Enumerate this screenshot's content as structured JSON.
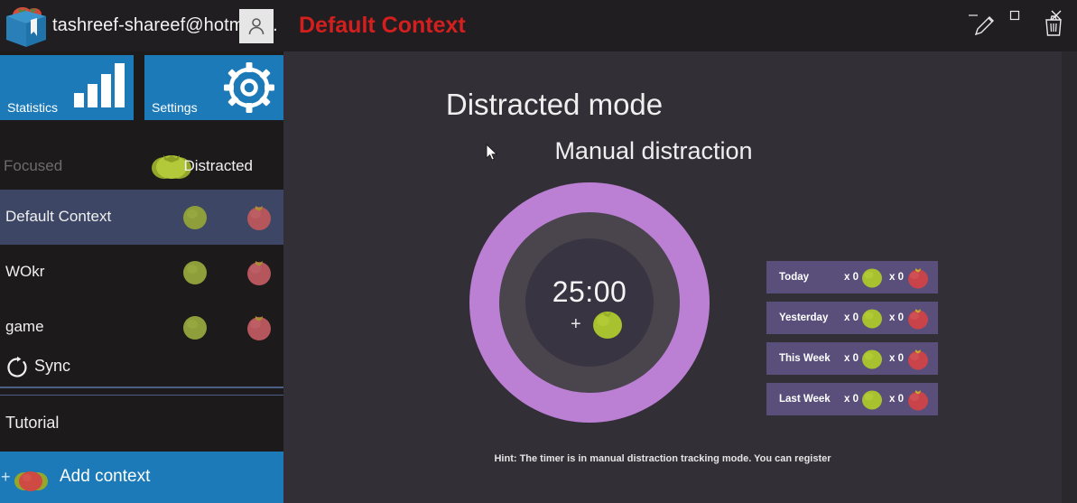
{
  "titlebar": {
    "logo_icon": "tomato-crate-logo",
    "account_name": "tashreef-shareef@hotmail...",
    "avatar_icon": "person-icon",
    "context_title": "Default Context",
    "minimize_label": "–",
    "maximize_label": "□",
    "close_label": "✕",
    "edit_icon": "pencil-icon",
    "delete_icon": "trash-icon"
  },
  "sidebar": {
    "tiles": [
      {
        "label": "Statistics",
        "icon": "bar-chart-icon"
      },
      {
        "label": "Settings",
        "icon": "gear-icon"
      }
    ],
    "mode": {
      "focused_label": "Focused",
      "distracted_label": "Distracted",
      "active": "Distracted",
      "toggle_icon": "green-tomato-toggle"
    },
    "contexts": [
      {
        "name": "Default Context",
        "selected": true
      },
      {
        "name": "WOkr",
        "selected": false
      },
      {
        "name": "game",
        "selected": false
      }
    ],
    "sync_label": "Sync",
    "sync_icon": "refresh-icon",
    "tutorial_label": "Tutorial",
    "add_context_label": "Add context",
    "add_context_plus": "+",
    "add_context_icon": "tomato-icon"
  },
  "main": {
    "title": "Distracted mode",
    "subtitle": "Manual distraction",
    "timer_value": "25:00",
    "timer_plus": "+",
    "timer_tomato_icon": "green-tomato-icon",
    "hint": "Hint: The timer is in manual distraction tracking mode. You can register"
  },
  "stats": {
    "rows": [
      {
        "label": "Today",
        "green_count": "x 0",
        "red_count": "x 0"
      },
      {
        "label": "Yesterday",
        "green_count": "x 0",
        "red_count": "x 0"
      },
      {
        "label": "This Week",
        "green_count": "x 0",
        "red_count": "x 0"
      },
      {
        "label": "Last Week",
        "green_count": "x 0",
        "red_count": "x 0"
      }
    ]
  },
  "colors": {
    "accent_blue": "#1c7ab8",
    "title_red": "#d41f1f",
    "ring_purple": "#bb7fd4",
    "stat_tile": "#594f7a",
    "selected_row": "#3d4765",
    "green_tomato": "#a8c12e",
    "red_tomato": "#c9444a"
  }
}
